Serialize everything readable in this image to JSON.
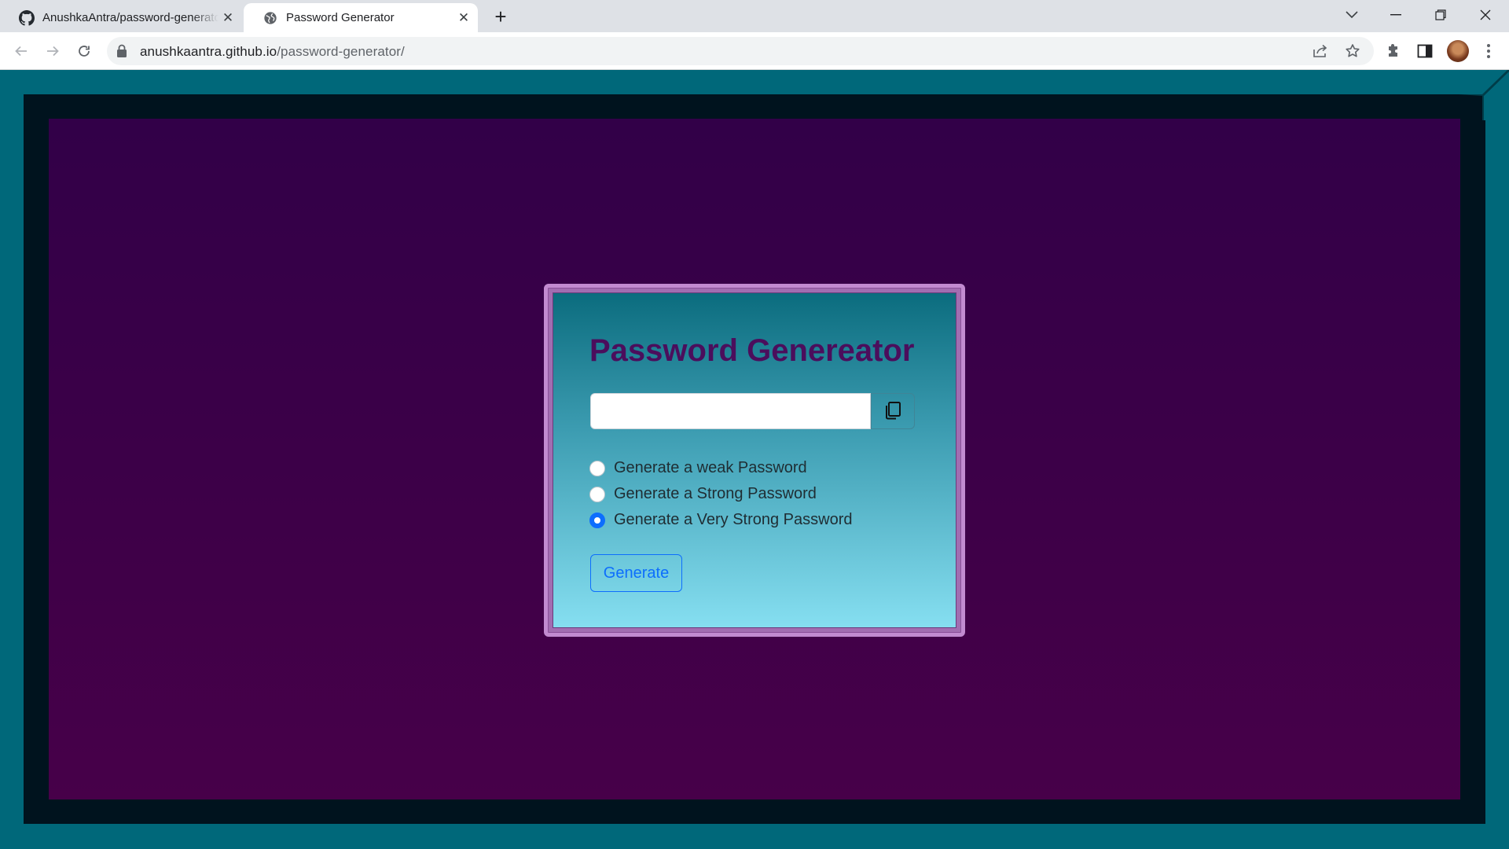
{
  "browser": {
    "tabs": [
      {
        "title": "AnushkaAntra/password-generator",
        "icon": "github-icon"
      },
      {
        "title": "Password Generator",
        "icon": "globe-icon"
      }
    ],
    "url_host": "anushkaantra.github.io",
    "url_path": "/password-generator/"
  },
  "page": {
    "heading": "Password Genereator",
    "password_value": "",
    "copy_icon": "copy-icon",
    "options": [
      {
        "label": "Generate a weak Password",
        "checked": false
      },
      {
        "label": "Generate a Strong Password",
        "checked": false
      },
      {
        "label": "Generate a Very Strong Password",
        "checked": true
      }
    ],
    "generate_label": "Generate"
  },
  "colors": {
    "frame_teal": "#00687a",
    "frame_dark": "#00131e",
    "background_purple": "#3c0048",
    "card_border": "#c28ad0",
    "heading_color": "#4b0e5c",
    "accent_blue": "#0d6efd"
  }
}
